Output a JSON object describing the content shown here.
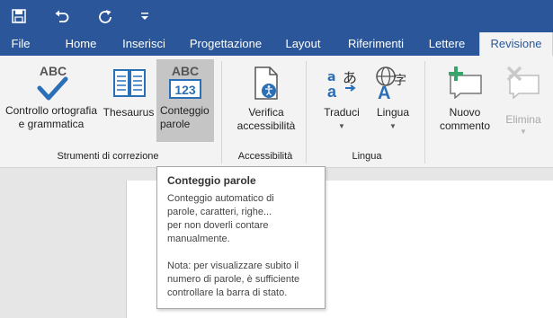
{
  "quick_access": {
    "save_icon": "save-icon",
    "undo_icon": "undo-icon",
    "redo_icon": "redo-icon",
    "customize_icon": "customize-qat-icon"
  },
  "tabs": [
    {
      "label": "File"
    },
    {
      "label": "Home"
    },
    {
      "label": "Inserisci"
    },
    {
      "label": "Progettazione"
    },
    {
      "label": "Layout"
    },
    {
      "label": "Riferimenti"
    },
    {
      "label": "Lettere"
    },
    {
      "label": "Revisione",
      "active": true
    }
  ],
  "ribbon": {
    "groups": {
      "correction": {
        "label": "Strumenti di correzione",
        "spelling": {
          "label": "Controllo ortografia\ne grammatica",
          "icon_text": "ABC"
        },
        "thesaurus": {
          "label": "Thesaurus"
        },
        "word_count": {
          "label": "Conteggio\nparole",
          "icon_text_top": "ABC",
          "icon_text_bottom": "123"
        }
      },
      "accessibility": {
        "label": "Accessibilità",
        "check": {
          "label": "Verifica\naccessibilità"
        }
      },
      "language": {
        "label": "Lingua",
        "translate": {
          "label": "Traduci"
        },
        "language": {
          "label": "Lingua"
        }
      },
      "comments": {
        "new_comment": {
          "label": "Nuovo\ncommento"
        },
        "delete": {
          "label": "Elimina"
        }
      }
    }
  },
  "tooltip": {
    "title": "Conteggio parole",
    "body1": "Conteggio automatico di\nparole, caratteri, righe...\nper non doverli contare\nmanualmente.",
    "body2": "Nota: per visualizzare subito il\nnumero di parole, è sufficiente\ncontrollare la barra di stato."
  },
  "colors": {
    "accent": "#2b579a",
    "ribbon_bg": "#f3f3f3",
    "hover": "#c5c5c5"
  }
}
